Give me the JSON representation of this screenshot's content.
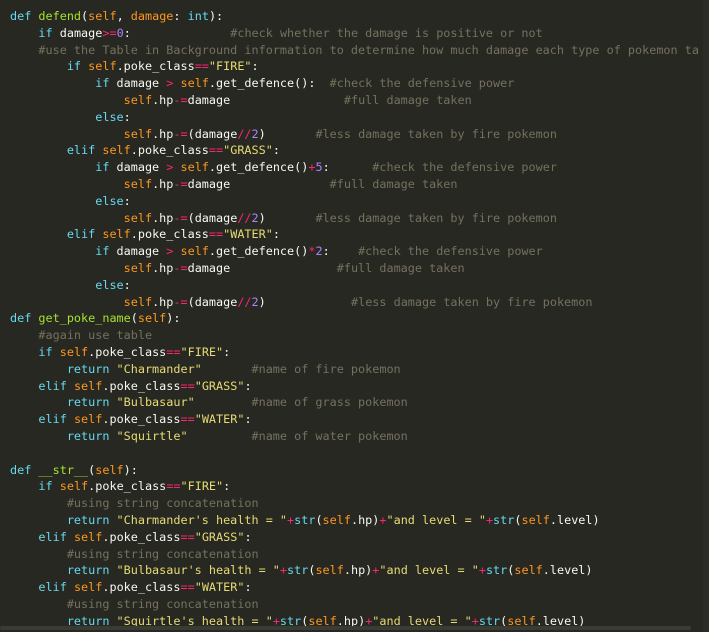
{
  "editor": {
    "lines": [
      {
        "indent": 0,
        "tokens": [
          [
            "kw",
            "def "
          ],
          [
            "fn",
            "defend"
          ],
          [
            "pl",
            "("
          ],
          [
            "self",
            "self"
          ],
          [
            "pl",
            ", "
          ],
          [
            "self",
            "damage"
          ],
          [
            "pl",
            ": "
          ],
          [
            "kw",
            "int"
          ],
          [
            "pl",
            "):"
          ]
        ]
      },
      {
        "indent": 1,
        "tokens": [
          [
            "kw",
            "if "
          ],
          [
            "pl",
            "damage"
          ],
          [
            "op",
            ">="
          ],
          [
            "num",
            "0"
          ],
          [
            "pl",
            ":              "
          ],
          [
            "cm",
            "#check whether the damage is positive or not"
          ]
        ]
      },
      {
        "indent": 1,
        "tokens": [
          [
            "cm",
            "#use the Table in Background information to determine how much damage each type of pokemon ta"
          ]
        ]
      },
      {
        "indent": 2,
        "tokens": [
          [
            "kw",
            "if "
          ],
          [
            "self",
            "self"
          ],
          [
            "pl",
            ".poke_class"
          ],
          [
            "op",
            "=="
          ],
          [
            "str",
            "\"FIRE\""
          ],
          [
            "pl",
            ":"
          ]
        ]
      },
      {
        "indent": 3,
        "tokens": [
          [
            "kw",
            "if "
          ],
          [
            "pl",
            "damage "
          ],
          [
            "op",
            ">"
          ],
          [
            "pl",
            " "
          ],
          [
            "self",
            "self"
          ],
          [
            "pl",
            ".get_defence():  "
          ],
          [
            "cm",
            "#check the defensive power"
          ]
        ]
      },
      {
        "indent": 4,
        "tokens": [
          [
            "self",
            "self"
          ],
          [
            "pl",
            ".hp"
          ],
          [
            "op",
            "-="
          ],
          [
            "pl",
            "damage                "
          ],
          [
            "cm",
            "#full damage taken"
          ]
        ]
      },
      {
        "indent": 3,
        "tokens": [
          [
            "kw",
            "else"
          ],
          [
            "pl",
            ":"
          ]
        ]
      },
      {
        "indent": 4,
        "tokens": [
          [
            "self",
            "self"
          ],
          [
            "pl",
            ".hp"
          ],
          [
            "op",
            "-="
          ],
          [
            "pl",
            "(damage"
          ],
          [
            "op",
            "//"
          ],
          [
            "num",
            "2"
          ],
          [
            "pl",
            ")       "
          ],
          [
            "cm",
            "#less damage taken by fire pokemon"
          ]
        ]
      },
      {
        "indent": 2,
        "tokens": [
          [
            "kw",
            "elif "
          ],
          [
            "self",
            "self"
          ],
          [
            "pl",
            ".poke_class"
          ],
          [
            "op",
            "=="
          ],
          [
            "str",
            "\"GRASS\""
          ],
          [
            "pl",
            ":"
          ]
        ]
      },
      {
        "indent": 3,
        "tokens": [
          [
            "kw",
            "if "
          ],
          [
            "pl",
            "damage "
          ],
          [
            "op",
            ">"
          ],
          [
            "pl",
            " "
          ],
          [
            "self",
            "self"
          ],
          [
            "pl",
            ".get_defence()"
          ],
          [
            "op",
            "+"
          ],
          [
            "num",
            "5"
          ],
          [
            "pl",
            ":      "
          ],
          [
            "cm",
            "#check the defensive power"
          ]
        ]
      },
      {
        "indent": 4,
        "tokens": [
          [
            "self",
            "self"
          ],
          [
            "pl",
            ".hp"
          ],
          [
            "op",
            "-="
          ],
          [
            "pl",
            "damage              "
          ],
          [
            "cm",
            "#full damage taken"
          ]
        ]
      },
      {
        "indent": 3,
        "tokens": [
          [
            "kw",
            "else"
          ],
          [
            "pl",
            ":"
          ]
        ]
      },
      {
        "indent": 4,
        "tokens": [
          [
            "self",
            "self"
          ],
          [
            "pl",
            ".hp"
          ],
          [
            "op",
            "-="
          ],
          [
            "pl",
            "(damage"
          ],
          [
            "op",
            "//"
          ],
          [
            "num",
            "2"
          ],
          [
            "pl",
            ")       "
          ],
          [
            "cm",
            "#less damage taken by fire pokemon"
          ]
        ]
      },
      {
        "indent": 2,
        "tokens": [
          [
            "kw",
            "elif "
          ],
          [
            "self",
            "self"
          ],
          [
            "pl",
            ".poke_class"
          ],
          [
            "op",
            "=="
          ],
          [
            "str",
            "\"WATER\""
          ],
          [
            "pl",
            ":"
          ]
        ]
      },
      {
        "indent": 3,
        "tokens": [
          [
            "kw",
            "if "
          ],
          [
            "pl",
            "damage "
          ],
          [
            "op",
            ">"
          ],
          [
            "pl",
            " "
          ],
          [
            "self",
            "self"
          ],
          [
            "pl",
            ".get_defence()"
          ],
          [
            "op",
            "*"
          ],
          [
            "num",
            "2"
          ],
          [
            "pl",
            ":    "
          ],
          [
            "cm",
            "#check the defensive power"
          ]
        ]
      },
      {
        "indent": 4,
        "tokens": [
          [
            "self",
            "self"
          ],
          [
            "pl",
            ".hp"
          ],
          [
            "op",
            "-="
          ],
          [
            "pl",
            "damage               "
          ],
          [
            "cm",
            "#full damage taken"
          ]
        ]
      },
      {
        "indent": 3,
        "tokens": [
          [
            "kw",
            "else"
          ],
          [
            "pl",
            ":"
          ]
        ]
      },
      {
        "indent": 4,
        "tokens": [
          [
            "self",
            "self"
          ],
          [
            "pl",
            ".hp"
          ],
          [
            "op",
            "-="
          ],
          [
            "pl",
            "(damage"
          ],
          [
            "op",
            "//"
          ],
          [
            "num",
            "2"
          ],
          [
            "pl",
            ")            "
          ],
          [
            "cm",
            "#less damage taken by fire pokemon"
          ]
        ]
      },
      {
        "indent": 0,
        "tokens": [
          [
            "kw",
            "def "
          ],
          [
            "fn",
            "get_poke_name"
          ],
          [
            "pl",
            "("
          ],
          [
            "self",
            "self"
          ],
          [
            "pl",
            "):"
          ]
        ]
      },
      {
        "indent": 1,
        "tokens": [
          [
            "cm",
            "#again use table"
          ]
        ]
      },
      {
        "indent": 1,
        "tokens": [
          [
            "kw",
            "if "
          ],
          [
            "self",
            "self"
          ],
          [
            "pl",
            ".poke_class"
          ],
          [
            "op",
            "=="
          ],
          [
            "str",
            "\"FIRE\""
          ],
          [
            "pl",
            ":"
          ]
        ]
      },
      {
        "indent": 2,
        "tokens": [
          [
            "kw",
            "return "
          ],
          [
            "str",
            "\"Charmander\""
          ],
          [
            "pl",
            "       "
          ],
          [
            "cm",
            "#name of fire pokemon"
          ]
        ]
      },
      {
        "indent": 1,
        "tokens": [
          [
            "kw",
            "elif "
          ],
          [
            "self",
            "self"
          ],
          [
            "pl",
            ".poke_class"
          ],
          [
            "op",
            "=="
          ],
          [
            "str",
            "\"GRASS\""
          ],
          [
            "pl",
            ":"
          ]
        ]
      },
      {
        "indent": 2,
        "tokens": [
          [
            "kw",
            "return "
          ],
          [
            "str",
            "\"Bulbasaur\""
          ],
          [
            "pl",
            "        "
          ],
          [
            "cm",
            "#name of grass pokemon"
          ]
        ]
      },
      {
        "indent": 1,
        "tokens": [
          [
            "kw",
            "elif "
          ],
          [
            "self",
            "self"
          ],
          [
            "pl",
            ".poke_class"
          ],
          [
            "op",
            "=="
          ],
          [
            "str",
            "\"WATER\""
          ],
          [
            "pl",
            ":"
          ]
        ]
      },
      {
        "indent": 2,
        "tokens": [
          [
            "kw",
            "return "
          ],
          [
            "str",
            "\"Squirtle\""
          ],
          [
            "pl",
            "         "
          ],
          [
            "cm",
            "#name of water pokemon"
          ]
        ]
      },
      {
        "indent": 0,
        "tokens": []
      },
      {
        "indent": 0,
        "tokens": [
          [
            "kw",
            "def "
          ],
          [
            "fn",
            "__str__"
          ],
          [
            "pl",
            "("
          ],
          [
            "self",
            "self"
          ],
          [
            "pl",
            "):"
          ]
        ]
      },
      {
        "indent": 1,
        "tokens": [
          [
            "kw",
            "if "
          ],
          [
            "self",
            "self"
          ],
          [
            "pl",
            ".poke_class"
          ],
          [
            "op",
            "=="
          ],
          [
            "str",
            "\"FIRE\""
          ],
          [
            "pl",
            ":"
          ]
        ]
      },
      {
        "indent": 2,
        "tokens": [
          [
            "cm",
            "#using string concatenation"
          ]
        ]
      },
      {
        "indent": 2,
        "tokens": [
          [
            "kw",
            "return "
          ],
          [
            "str",
            "\"Charmander's health = \""
          ],
          [
            "op",
            "+"
          ],
          [
            "kw",
            "str"
          ],
          [
            "pl",
            "("
          ],
          [
            "self",
            "self"
          ],
          [
            "pl",
            ".hp)"
          ],
          [
            "op",
            "+"
          ],
          [
            "str",
            "\"and level = \""
          ],
          [
            "op",
            "+"
          ],
          [
            "kw",
            "str"
          ],
          [
            "pl",
            "("
          ],
          [
            "self",
            "self"
          ],
          [
            "pl",
            ".level)"
          ]
        ]
      },
      {
        "indent": 1,
        "tokens": [
          [
            "kw",
            "elif "
          ],
          [
            "self",
            "self"
          ],
          [
            "pl",
            ".poke_class"
          ],
          [
            "op",
            "=="
          ],
          [
            "str",
            "\"GRASS\""
          ],
          [
            "pl",
            ":"
          ]
        ]
      },
      {
        "indent": 2,
        "tokens": [
          [
            "cm",
            "#using string concatenation"
          ]
        ]
      },
      {
        "indent": 2,
        "tokens": [
          [
            "kw",
            "return "
          ],
          [
            "str",
            "\"Bulbasaur's health = \""
          ],
          [
            "op",
            "+"
          ],
          [
            "kw",
            "str"
          ],
          [
            "pl",
            "("
          ],
          [
            "self",
            "self"
          ],
          [
            "pl",
            ".hp)"
          ],
          [
            "op",
            "+"
          ],
          [
            "str",
            "\"and level = \""
          ],
          [
            "op",
            "+"
          ],
          [
            "kw",
            "str"
          ],
          [
            "pl",
            "("
          ],
          [
            "self",
            "self"
          ],
          [
            "pl",
            ".level)"
          ]
        ]
      },
      {
        "indent": 1,
        "tokens": [
          [
            "kw",
            "elif "
          ],
          [
            "self",
            "self"
          ],
          [
            "pl",
            ".poke_class"
          ],
          [
            "op",
            "=="
          ],
          [
            "str",
            "\"WATER\""
          ],
          [
            "pl",
            ":"
          ]
        ]
      },
      {
        "indent": 2,
        "tokens": [
          [
            "cm",
            "#using string concatenation"
          ]
        ]
      },
      {
        "indent": 2,
        "tokens": [
          [
            "kw",
            "return "
          ],
          [
            "str",
            "\"Squirtle's health = \""
          ],
          [
            "op",
            "+"
          ],
          [
            "kw",
            "str"
          ],
          [
            "pl",
            "("
          ],
          [
            "self",
            "self"
          ],
          [
            "pl",
            ".hp)"
          ],
          [
            "op",
            "+"
          ],
          [
            "str",
            "\"and level = \""
          ],
          [
            "op",
            "+"
          ],
          [
            "kw",
            "str"
          ],
          [
            "pl",
            "("
          ],
          [
            "self",
            "self"
          ],
          [
            "pl",
            ".level)"
          ]
        ]
      }
    ]
  },
  "colors": {
    "background": "#272822",
    "keyword": "#66d9ef",
    "function": "#a6e22e",
    "operator": "#f92672",
    "number": "#ae81ff",
    "string": "#e6db74",
    "comment": "#75715e",
    "plain": "#f8f8f2",
    "self": "#fd971f"
  }
}
